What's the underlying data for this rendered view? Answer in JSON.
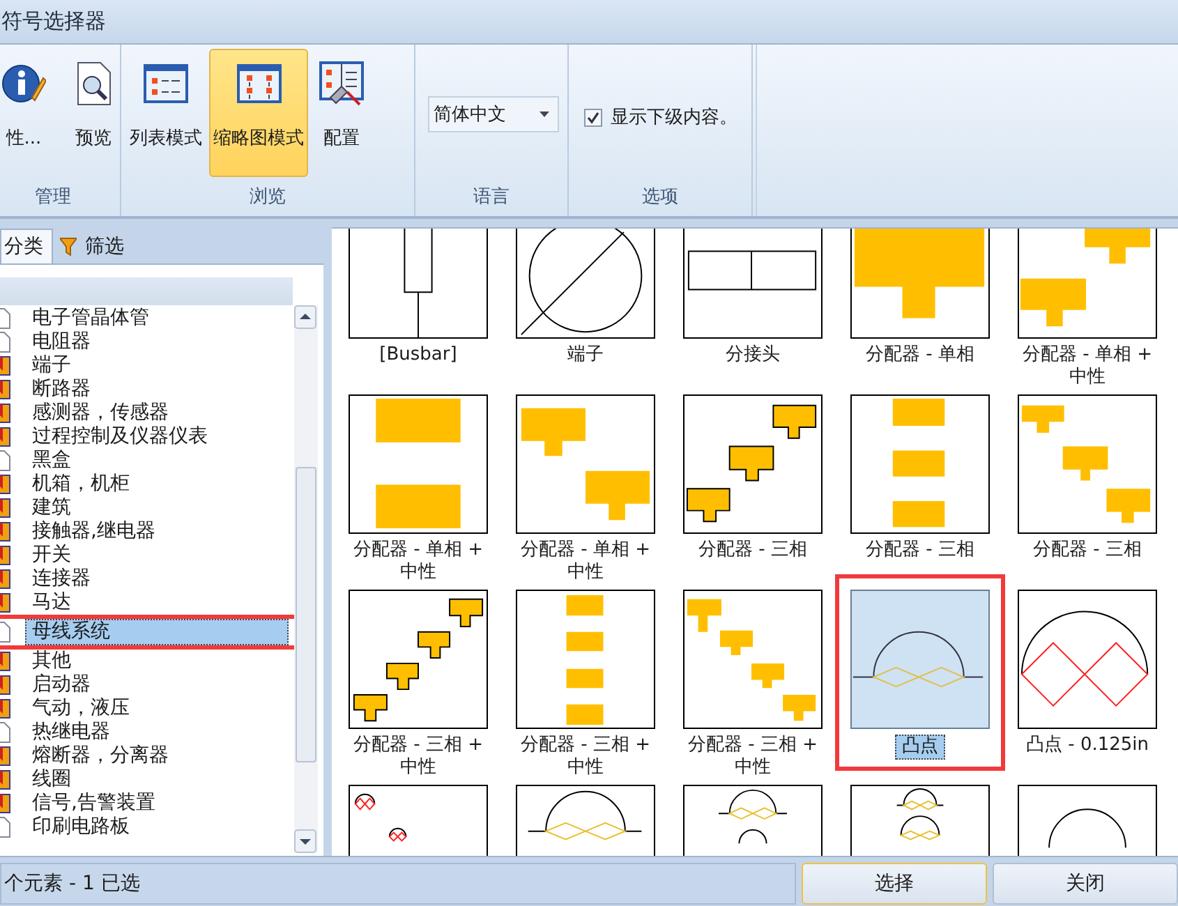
{
  "window": {
    "title": "符号选择器"
  },
  "ribbon": {
    "groups": [
      {
        "label": "管理",
        "kind": "buttons",
        "buttons": [
          {
            "kind": "info",
            "label": "性...",
            "selected": false
          },
          {
            "kind": "preview",
            "label": "预览",
            "selected": false
          }
        ]
      },
      {
        "label": "浏览",
        "kind": "buttons",
        "buttons": [
          {
            "kind": "list",
            "label": "列表模式",
            "selected": false
          },
          {
            "kind": "thumbnails",
            "label": "缩略图模式",
            "selected": true
          },
          {
            "kind": "config",
            "label": "配置",
            "selected": false
          }
        ]
      },
      {
        "label": "语言",
        "kind": "dropdown",
        "value": "简体中文"
      },
      {
        "label": "选项",
        "kind": "checkbox",
        "checkbox": {
          "label": "显示下级内容。",
          "checked": true
        }
      }
    ]
  },
  "panel_tabs": [
    {
      "label": "分类",
      "kind": "plain",
      "selected": true
    },
    {
      "label": "筛选",
      "kind": "filter",
      "selected": false
    }
  ],
  "tree": {
    "items": [
      {
        "label": "电子管晶体管",
        "kind": "page",
        "selected": false,
        "annotated": false
      },
      {
        "label": "电阻器",
        "kind": "page",
        "selected": false,
        "annotated": false
      },
      {
        "label": "端子",
        "kind": "book",
        "selected": false,
        "annotated": false
      },
      {
        "label": "断路器",
        "kind": "book",
        "selected": false,
        "annotated": false
      },
      {
        "label": "感测器，传感器",
        "kind": "book",
        "selected": false,
        "annotated": false
      },
      {
        "label": "过程控制及仪器仪表",
        "kind": "book",
        "selected": false,
        "annotated": false
      },
      {
        "label": "黑盒",
        "kind": "page",
        "selected": false,
        "annotated": false
      },
      {
        "label": "机箱，机柜",
        "kind": "book",
        "selected": false,
        "annotated": false
      },
      {
        "label": "建筑",
        "kind": "book",
        "selected": false,
        "annotated": false
      },
      {
        "label": "接触器,继电器",
        "kind": "book",
        "selected": false,
        "annotated": false
      },
      {
        "label": "开关",
        "kind": "book",
        "selected": false,
        "annotated": false
      },
      {
        "label": "连接器",
        "kind": "book",
        "selected": false,
        "annotated": false
      },
      {
        "label": "马达",
        "kind": "book",
        "selected": false,
        "annotated": false
      },
      {
        "label": "母线系统",
        "kind": "page",
        "selected": true,
        "annotated": true
      },
      {
        "label": "其他",
        "kind": "book",
        "selected": false,
        "annotated": false
      },
      {
        "label": "启动器",
        "kind": "book",
        "selected": false,
        "annotated": false
      },
      {
        "label": "气动，液压",
        "kind": "book",
        "selected": false,
        "annotated": false
      },
      {
        "label": "热继电器",
        "kind": "page",
        "selected": false,
        "annotated": false
      },
      {
        "label": "熔断器，分离器",
        "kind": "book",
        "selected": false,
        "annotated": false
      },
      {
        "label": "线圈",
        "kind": "book",
        "selected": false,
        "annotated": false
      },
      {
        "label": "信号,告警装置",
        "kind": "book",
        "selected": false,
        "annotated": false
      },
      {
        "label": "印刷电路板",
        "kind": "page",
        "selected": false,
        "annotated": false
      }
    ]
  },
  "symbols": [
    {
      "label": "[Busbar]",
      "kind": "busbar",
      "selected": false,
      "annotated": false
    },
    {
      "label": "端子",
      "kind": "terminal",
      "selected": false,
      "annotated": false
    },
    {
      "label": "分接头",
      "kind": "splice",
      "selected": false,
      "annotated": false
    },
    {
      "label": "分配器 - 单相",
      "kind": "dist-1ph",
      "selected": false,
      "annotated": false
    },
    {
      "label": "分配器 - 单相 + 中性",
      "kind": "dist-1ph-n-a",
      "selected": false,
      "annotated": false
    },
    {
      "label": "分配器 - 单相 + 中性",
      "kind": "dist-1ph-n-b",
      "selected": false,
      "annotated": false
    },
    {
      "label": "分配器 - 单相 + 中性",
      "kind": "dist-1ph-n-c",
      "selected": false,
      "annotated": false
    },
    {
      "label": "分配器 - 三相",
      "kind": "dist-3ph-a",
      "selected": false,
      "annotated": false
    },
    {
      "label": "分配器 - 三相",
      "kind": "dist-3ph-b",
      "selected": false,
      "annotated": false
    },
    {
      "label": "分配器 - 三相",
      "kind": "dist-3ph-c",
      "selected": false,
      "annotated": false
    },
    {
      "label": "分配器 - 三相 + 中性",
      "kind": "dist-3ph-n-a",
      "selected": false,
      "annotated": false
    },
    {
      "label": "分配器 - 三相 + 中性",
      "kind": "dist-3ph-n-b",
      "selected": false,
      "annotated": false
    },
    {
      "label": "分配器 - 三相 + 中性",
      "kind": "dist-3ph-n-c",
      "selected": false,
      "annotated": false
    },
    {
      "label": "凸点",
      "kind": "bump",
      "selected": true,
      "annotated": true
    },
    {
      "label": "凸点 - 0.125in",
      "kind": "bump-red",
      "selected": false,
      "annotated": false
    },
    {
      "kind": "bump-small-red",
      "selected": false
    },
    {
      "kind": "bump-yellow",
      "selected": false
    },
    {
      "kind": "bump-yellow-small",
      "selected": false
    },
    {
      "kind": "bump-stack",
      "selected": false
    },
    {
      "kind": "bump-plain",
      "selected": false
    }
  ],
  "status_bar": {
    "text": "个元素 - 1 已选",
    "buttons": [
      {
        "label": "选择",
        "focused": true
      },
      {
        "label": "关闭",
        "focused": false
      }
    ]
  }
}
